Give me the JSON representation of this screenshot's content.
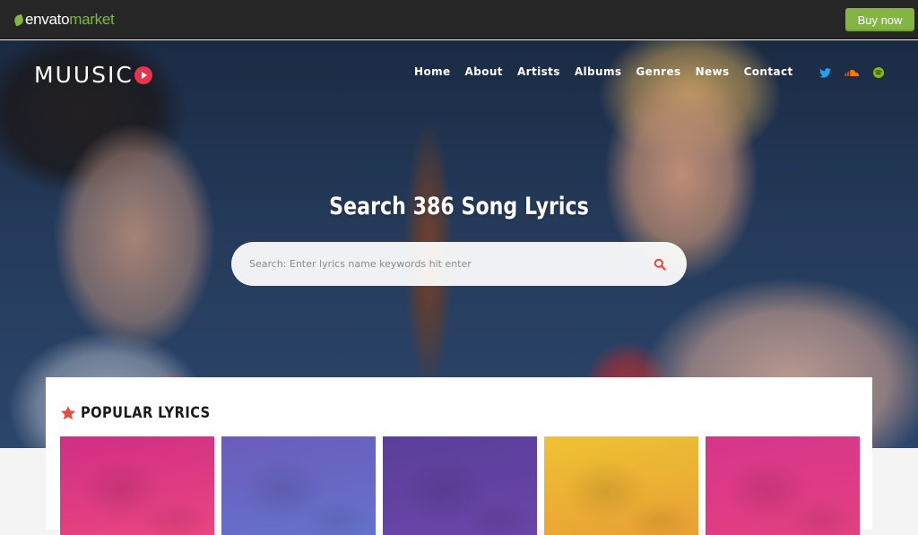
{
  "envato_bar": {
    "logo_primary": "envato",
    "logo_secondary": "market",
    "buy_now_label": "Buy now",
    "accent_color": "#82b541"
  },
  "site": {
    "logo_text": "MUUSIC",
    "logo_badge_icon": "play-icon",
    "brand_color": "#e8334d"
  },
  "nav": {
    "items": [
      {
        "label": "Home"
      },
      {
        "label": "About"
      },
      {
        "label": "Artists"
      },
      {
        "label": "Albums"
      },
      {
        "label": "Genres"
      },
      {
        "label": "News"
      },
      {
        "label": "Contact"
      }
    ]
  },
  "social": {
    "items": [
      {
        "name": "twitter-icon",
        "color": "#1da1f2"
      },
      {
        "name": "soundcloud-icon",
        "color": "#ff7700"
      },
      {
        "name": "spotify-icon",
        "color": "#84bd00"
      }
    ]
  },
  "hero": {
    "title": "Search 386 Song Lyrics",
    "search_placeholder": "Search: Enter lyrics name keywords hit enter",
    "search_value": "",
    "search_icon": "search-icon",
    "search_icon_color": "#e8473e"
  },
  "popular": {
    "title": "POPULAR LYRICS",
    "icon": "star-icon",
    "icon_color": "#e74c3c",
    "cards": [
      {
        "color_top": "#d12e86",
        "color_bottom": "#e8467f"
      },
      {
        "color_top": "#6c5cbb",
        "color_bottom": "#6472cc"
      },
      {
        "color_top": "#5a3f9a",
        "color_bottom": "#6a45a8"
      },
      {
        "color_top": "#eec233",
        "color_bottom": "#e9a035"
      },
      {
        "color_top": "#d7358c",
        "color_bottom": "#e2407f"
      }
    ]
  }
}
